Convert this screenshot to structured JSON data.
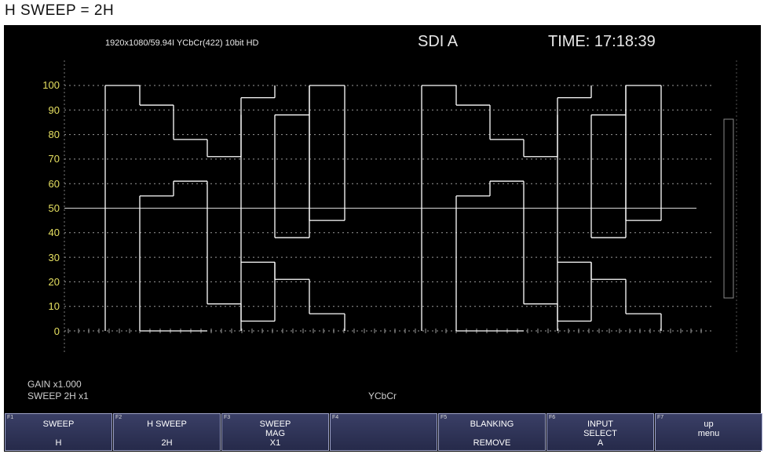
{
  "caption": "H SWEEP = 2H",
  "header": {
    "format": "1920x1080/59.94I YCbCr(422) 10bit HD",
    "source": "SDI A",
    "time": "TIME: 17:18:39"
  },
  "scale": {
    "labels": [
      "100",
      "90",
      "80",
      "70",
      "60",
      "50",
      "40",
      "30",
      "20",
      "10",
      "0"
    ],
    "label_color": "#e6e060"
  },
  "status": {
    "gain": "GAIN x1.000",
    "sweep": "SWEEP 2H x1",
    "display": "YCbCr"
  },
  "menu": [
    {
      "num": "F1",
      "label": "SWEEP",
      "value": "H"
    },
    {
      "num": "F2",
      "label": "H SWEEP",
      "value": "2H"
    },
    {
      "num": "F3",
      "label": "SWEEP\nMAG",
      "value": "X1"
    },
    {
      "num": "F4",
      "label": "",
      "value": ""
    },
    {
      "num": "F5",
      "label": "BLANKING",
      "value": "REMOVE"
    },
    {
      "num": "F6",
      "label": "INPUT\nSELECT",
      "value": "A"
    },
    {
      "num": "F7",
      "label": "up\nmenu",
      "value": ""
    }
  ],
  "waveform": {
    "y_levels": [
      100,
      92,
      78,
      71,
      55,
      61,
      11,
      4,
      95,
      88,
      28,
      21,
      7,
      100,
      38,
      45
    ],
    "trace_color": "#ffffff"
  }
}
